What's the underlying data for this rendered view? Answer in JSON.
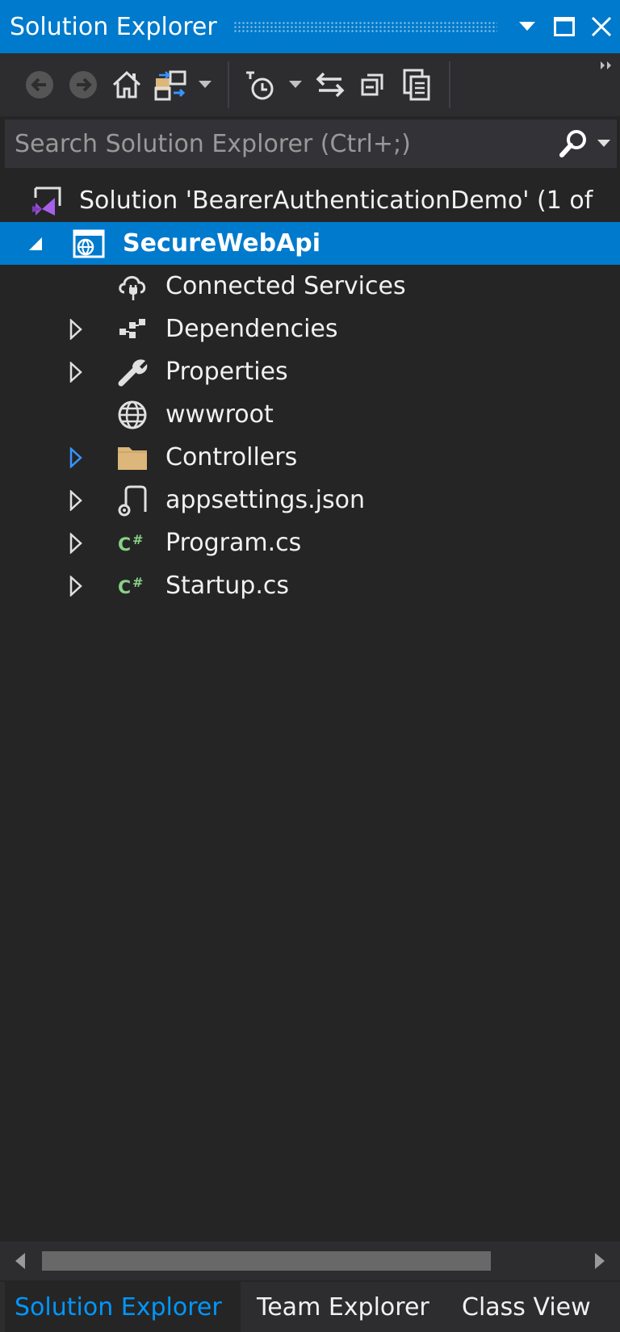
{
  "window": {
    "title": "Solution Explorer"
  },
  "toolbar": {
    "buttons": [
      {
        "name": "back-icon"
      },
      {
        "name": "forward-icon"
      },
      {
        "name": "home-icon"
      },
      {
        "name": "switch-views-icon"
      },
      {
        "name": "dropdown-arrow-icon"
      },
      {
        "name": "pending-changes-filter-icon"
      },
      {
        "name": "dropdown-arrow-icon"
      },
      {
        "name": "sync-with-active-document-icon"
      },
      {
        "name": "collapse-all-icon"
      },
      {
        "name": "show-all-files-icon"
      }
    ]
  },
  "search": {
    "placeholder": "Search Solution Explorer (Ctrl+;)"
  },
  "tree": {
    "solution": {
      "label": "Solution 'BearerAuthenticationDemo' (1 of",
      "icon": "solution-icon"
    },
    "project": {
      "label": "SecureWebApi",
      "icon": "web-project-icon",
      "expanded": true,
      "selected": true
    },
    "items": [
      {
        "label": "Connected Services",
        "icon": "connected-services-icon",
        "expander": "none"
      },
      {
        "label": "Dependencies",
        "icon": "dependencies-icon",
        "expander": "collapsed"
      },
      {
        "label": "Properties",
        "icon": "wrench-icon",
        "expander": "collapsed"
      },
      {
        "label": "wwwroot",
        "icon": "globe-icon",
        "expander": "none"
      },
      {
        "label": "Controllers",
        "icon": "folder-icon",
        "expander": "collapsed-highlight"
      },
      {
        "label": "appsettings.json",
        "icon": "json-file-icon",
        "expander": "collapsed"
      },
      {
        "label": "Program.cs",
        "icon": "csharp-file-icon",
        "expander": "collapsed"
      },
      {
        "label": "Startup.cs",
        "icon": "csharp-file-icon",
        "expander": "collapsed"
      }
    ]
  },
  "tabs": [
    {
      "label": "Solution Explorer",
      "active": true
    },
    {
      "label": "Team Explorer",
      "active": false
    },
    {
      "label": "Class View",
      "active": false
    }
  ],
  "colors": {
    "accent": "#007acc",
    "background": "#252526",
    "toolbar": "#2d2d30",
    "active_tab_text": "#0097fb",
    "folder": "#dcb67a",
    "csharp": "#89d185"
  }
}
